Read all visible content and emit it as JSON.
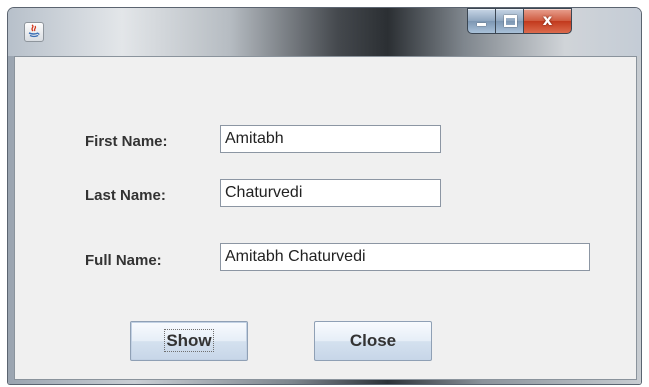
{
  "window": {
    "title": "",
    "controls": {
      "minimize_icon": "minimize-icon",
      "maximize_icon": "maximize-icon",
      "close_glyph": "x"
    }
  },
  "form": {
    "first_name": {
      "label": "First Name:",
      "value": "Amitabh"
    },
    "last_name": {
      "label": "Last Name:",
      "value": "Chaturvedi"
    },
    "full_name": {
      "label": "Full Name:",
      "value": "Amitabh Chaturvedi"
    }
  },
  "buttons": {
    "show": "Show",
    "close": "Close"
  },
  "colors": {
    "panel_bg": "#f0f0f0",
    "close_button": "#c2391d",
    "label_text": "#333333"
  }
}
